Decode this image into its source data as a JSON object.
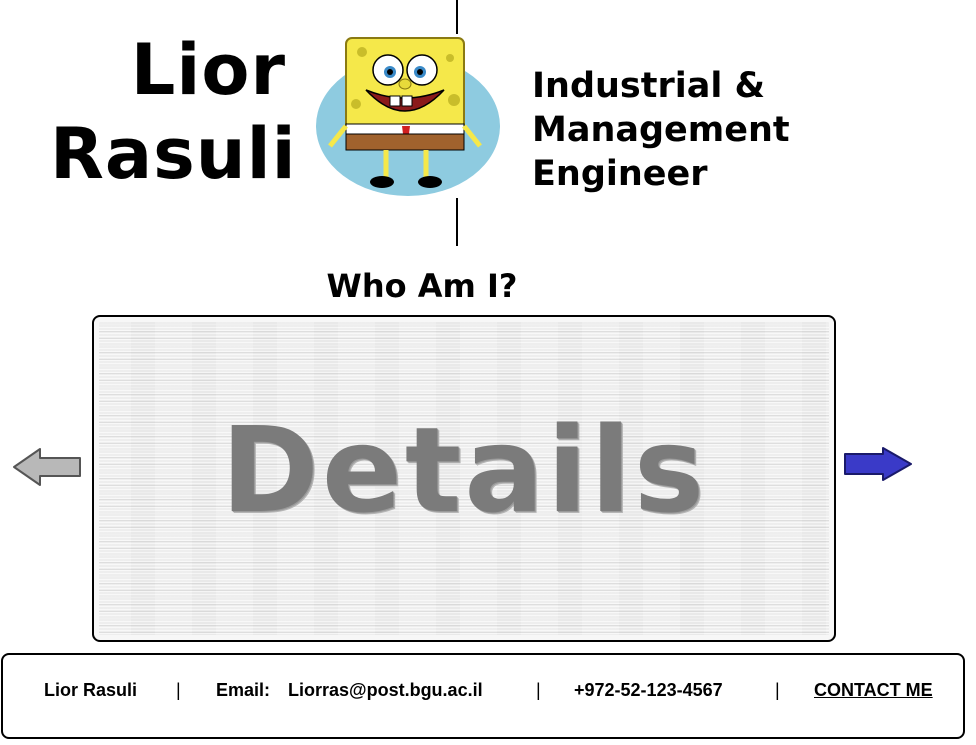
{
  "header": {
    "name_line1": "Lior",
    "name_line2": "Rasuli",
    "title_line1": "Industrial &",
    "title_line2": "Management",
    "title_line3": "Engineer",
    "avatar_icon": "spongebob-character-icon"
  },
  "section": {
    "heading": "Who Am I?",
    "panel_label": "Details",
    "prev_icon": "left-arrow-icon",
    "next_icon": "right-arrow-icon",
    "prev_color": "#b8b8b8",
    "next_color": "#3a3ac8"
  },
  "footer": {
    "name": "Lior Rasuli",
    "separator": "|",
    "email_label": "Email:",
    "email": "Liorras@post.bgu.ac.il",
    "phone": "+972-52-123-4567",
    "contact_label": "CONTACT ME"
  },
  "colors": {
    "panel_text": "#7b7b7b",
    "avatar_bg": "#8ecbe0"
  }
}
